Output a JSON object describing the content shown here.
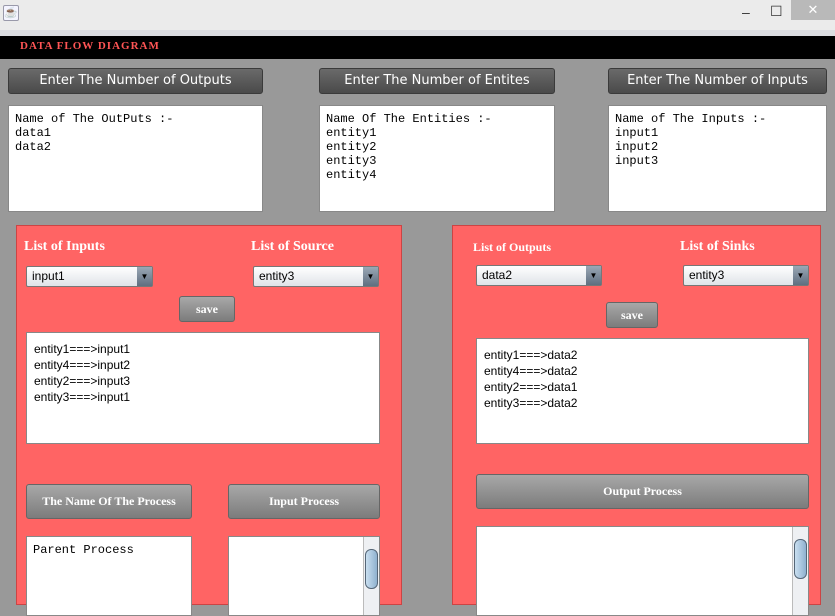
{
  "window": {
    "minimize": "–",
    "maximize": "☐",
    "close": "✕",
    "app_icon": "java-icon"
  },
  "header": {
    "title": "DATA  FLOW DIAGRAM"
  },
  "top": {
    "outputs_button": "Enter The Number of Outputs",
    "entities_button": "Enter The Number of Entites",
    "inputs_button": "Enter The Number of Inputs",
    "outputs_text": "Name of The OutPuts :-\ndata1\ndata2",
    "entities_text": "Name Of The Entities :-\nentity1\nentity2\nentity3\nentity4",
    "inputs_text": "Name of The Inputs :-\ninput1\ninput2\ninput3"
  },
  "left": {
    "inputs_label": "List of  Inputs",
    "source_label": "List of  Source",
    "inputs_selected": "input1",
    "source_selected": "entity3",
    "save": "save",
    "mappings": [
      "entity1===>input1",
      "entity4===>input2",
      "entity2===>input3",
      "entity3===>input1"
    ],
    "process_name_button": "The Name Of The Process",
    "input_process_button": "Input Process",
    "process_text": "Parent Process"
  },
  "right": {
    "outputs_label": "List of  Outputs",
    "sinks_label": "List of  Sinks",
    "outputs_selected": "data2",
    "sinks_selected": "entity3",
    "save": "save",
    "mappings": [
      "entity1===>data2",
      "entity4===>data2",
      "entity2===>data1",
      "entity3===>data2"
    ],
    "output_process_button": "Output Process"
  }
}
